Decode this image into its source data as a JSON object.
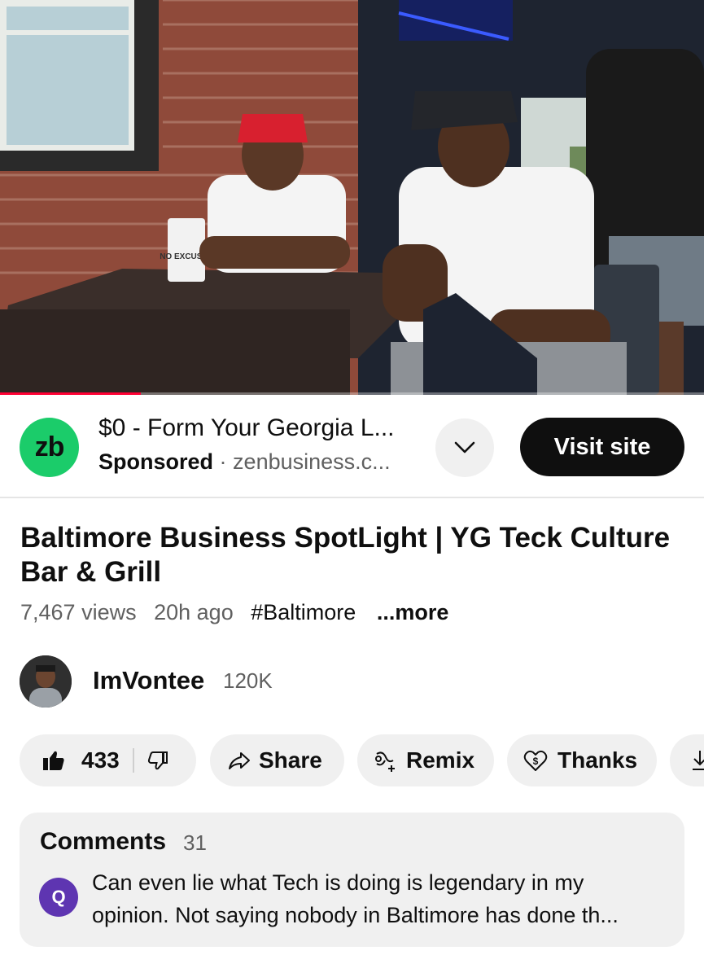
{
  "video": {
    "progress_fraction": 0.2,
    "accent_color": "#ff0033",
    "cup_text": "NO EXCUSES"
  },
  "ad": {
    "logo_text": "zb",
    "logo_color": "#1bcc6a",
    "title": "$0 - Form Your Georgia L...",
    "sponsored_label": "Sponsored",
    "separator": "·",
    "domain": "zenbusiness.c...",
    "expand_icon": "chevron-down-icon",
    "cta_label": "Visit site"
  },
  "video_info": {
    "title": "Baltimore Business SpotLight | YG Teck Culture Bar & Grill",
    "views": "7,467 views",
    "age": "20h ago",
    "hashtag": "#Baltimore",
    "more_label": "...more"
  },
  "channel": {
    "name": "ImVontee",
    "subscribers": "120K"
  },
  "actions": {
    "like_count": "433",
    "like_icon": "thumbs-up-icon",
    "dislike_icon": "thumbs-down-icon",
    "share_label": "Share",
    "remix_label": "Remix",
    "thanks_label": "Thanks",
    "download_icon": "download-icon"
  },
  "comments": {
    "heading": "Comments",
    "count": "31",
    "top_comment": {
      "avatar_letter": "Q",
      "avatar_color": "#5e35b1",
      "text": "Can even lie what Tech is doing is legendary in my opinion. Not saying nobody in Baltimore has done th..."
    }
  }
}
